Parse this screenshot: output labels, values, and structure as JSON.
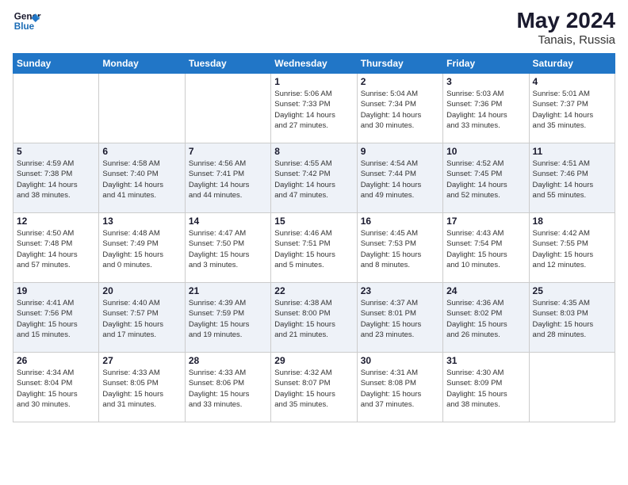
{
  "header": {
    "logo_line1": "General",
    "logo_line2": "Blue",
    "month_year": "May 2024",
    "location": "Tanais, Russia"
  },
  "weekdays": [
    "Sunday",
    "Monday",
    "Tuesday",
    "Wednesday",
    "Thursday",
    "Friday",
    "Saturday"
  ],
  "weeks": [
    [
      {
        "day": "",
        "info": ""
      },
      {
        "day": "",
        "info": ""
      },
      {
        "day": "",
        "info": ""
      },
      {
        "day": "1",
        "info": "Sunrise: 5:06 AM\nSunset: 7:33 PM\nDaylight: 14 hours\nand 27 minutes."
      },
      {
        "day": "2",
        "info": "Sunrise: 5:04 AM\nSunset: 7:34 PM\nDaylight: 14 hours\nand 30 minutes."
      },
      {
        "day": "3",
        "info": "Sunrise: 5:03 AM\nSunset: 7:36 PM\nDaylight: 14 hours\nand 33 minutes."
      },
      {
        "day": "4",
        "info": "Sunrise: 5:01 AM\nSunset: 7:37 PM\nDaylight: 14 hours\nand 35 minutes."
      }
    ],
    [
      {
        "day": "5",
        "info": "Sunrise: 4:59 AM\nSunset: 7:38 PM\nDaylight: 14 hours\nand 38 minutes."
      },
      {
        "day": "6",
        "info": "Sunrise: 4:58 AM\nSunset: 7:40 PM\nDaylight: 14 hours\nand 41 minutes."
      },
      {
        "day": "7",
        "info": "Sunrise: 4:56 AM\nSunset: 7:41 PM\nDaylight: 14 hours\nand 44 minutes."
      },
      {
        "day": "8",
        "info": "Sunrise: 4:55 AM\nSunset: 7:42 PM\nDaylight: 14 hours\nand 47 minutes."
      },
      {
        "day": "9",
        "info": "Sunrise: 4:54 AM\nSunset: 7:44 PM\nDaylight: 14 hours\nand 49 minutes."
      },
      {
        "day": "10",
        "info": "Sunrise: 4:52 AM\nSunset: 7:45 PM\nDaylight: 14 hours\nand 52 minutes."
      },
      {
        "day": "11",
        "info": "Sunrise: 4:51 AM\nSunset: 7:46 PM\nDaylight: 14 hours\nand 55 minutes."
      }
    ],
    [
      {
        "day": "12",
        "info": "Sunrise: 4:50 AM\nSunset: 7:48 PM\nDaylight: 14 hours\nand 57 minutes."
      },
      {
        "day": "13",
        "info": "Sunrise: 4:48 AM\nSunset: 7:49 PM\nDaylight: 15 hours\nand 0 minutes."
      },
      {
        "day": "14",
        "info": "Sunrise: 4:47 AM\nSunset: 7:50 PM\nDaylight: 15 hours\nand 3 minutes."
      },
      {
        "day": "15",
        "info": "Sunrise: 4:46 AM\nSunset: 7:51 PM\nDaylight: 15 hours\nand 5 minutes."
      },
      {
        "day": "16",
        "info": "Sunrise: 4:45 AM\nSunset: 7:53 PM\nDaylight: 15 hours\nand 8 minutes."
      },
      {
        "day": "17",
        "info": "Sunrise: 4:43 AM\nSunset: 7:54 PM\nDaylight: 15 hours\nand 10 minutes."
      },
      {
        "day": "18",
        "info": "Sunrise: 4:42 AM\nSunset: 7:55 PM\nDaylight: 15 hours\nand 12 minutes."
      }
    ],
    [
      {
        "day": "19",
        "info": "Sunrise: 4:41 AM\nSunset: 7:56 PM\nDaylight: 15 hours\nand 15 minutes."
      },
      {
        "day": "20",
        "info": "Sunrise: 4:40 AM\nSunset: 7:57 PM\nDaylight: 15 hours\nand 17 minutes."
      },
      {
        "day": "21",
        "info": "Sunrise: 4:39 AM\nSunset: 7:59 PM\nDaylight: 15 hours\nand 19 minutes."
      },
      {
        "day": "22",
        "info": "Sunrise: 4:38 AM\nSunset: 8:00 PM\nDaylight: 15 hours\nand 21 minutes."
      },
      {
        "day": "23",
        "info": "Sunrise: 4:37 AM\nSunset: 8:01 PM\nDaylight: 15 hours\nand 23 minutes."
      },
      {
        "day": "24",
        "info": "Sunrise: 4:36 AM\nSunset: 8:02 PM\nDaylight: 15 hours\nand 26 minutes."
      },
      {
        "day": "25",
        "info": "Sunrise: 4:35 AM\nSunset: 8:03 PM\nDaylight: 15 hours\nand 28 minutes."
      }
    ],
    [
      {
        "day": "26",
        "info": "Sunrise: 4:34 AM\nSunset: 8:04 PM\nDaylight: 15 hours\nand 30 minutes."
      },
      {
        "day": "27",
        "info": "Sunrise: 4:33 AM\nSunset: 8:05 PM\nDaylight: 15 hours\nand 31 minutes."
      },
      {
        "day": "28",
        "info": "Sunrise: 4:33 AM\nSunset: 8:06 PM\nDaylight: 15 hours\nand 33 minutes."
      },
      {
        "day": "29",
        "info": "Sunrise: 4:32 AM\nSunset: 8:07 PM\nDaylight: 15 hours\nand 35 minutes."
      },
      {
        "day": "30",
        "info": "Sunrise: 4:31 AM\nSunset: 8:08 PM\nDaylight: 15 hours\nand 37 minutes."
      },
      {
        "day": "31",
        "info": "Sunrise: 4:30 AM\nSunset: 8:09 PM\nDaylight: 15 hours\nand 38 minutes."
      },
      {
        "day": "",
        "info": ""
      }
    ]
  ]
}
